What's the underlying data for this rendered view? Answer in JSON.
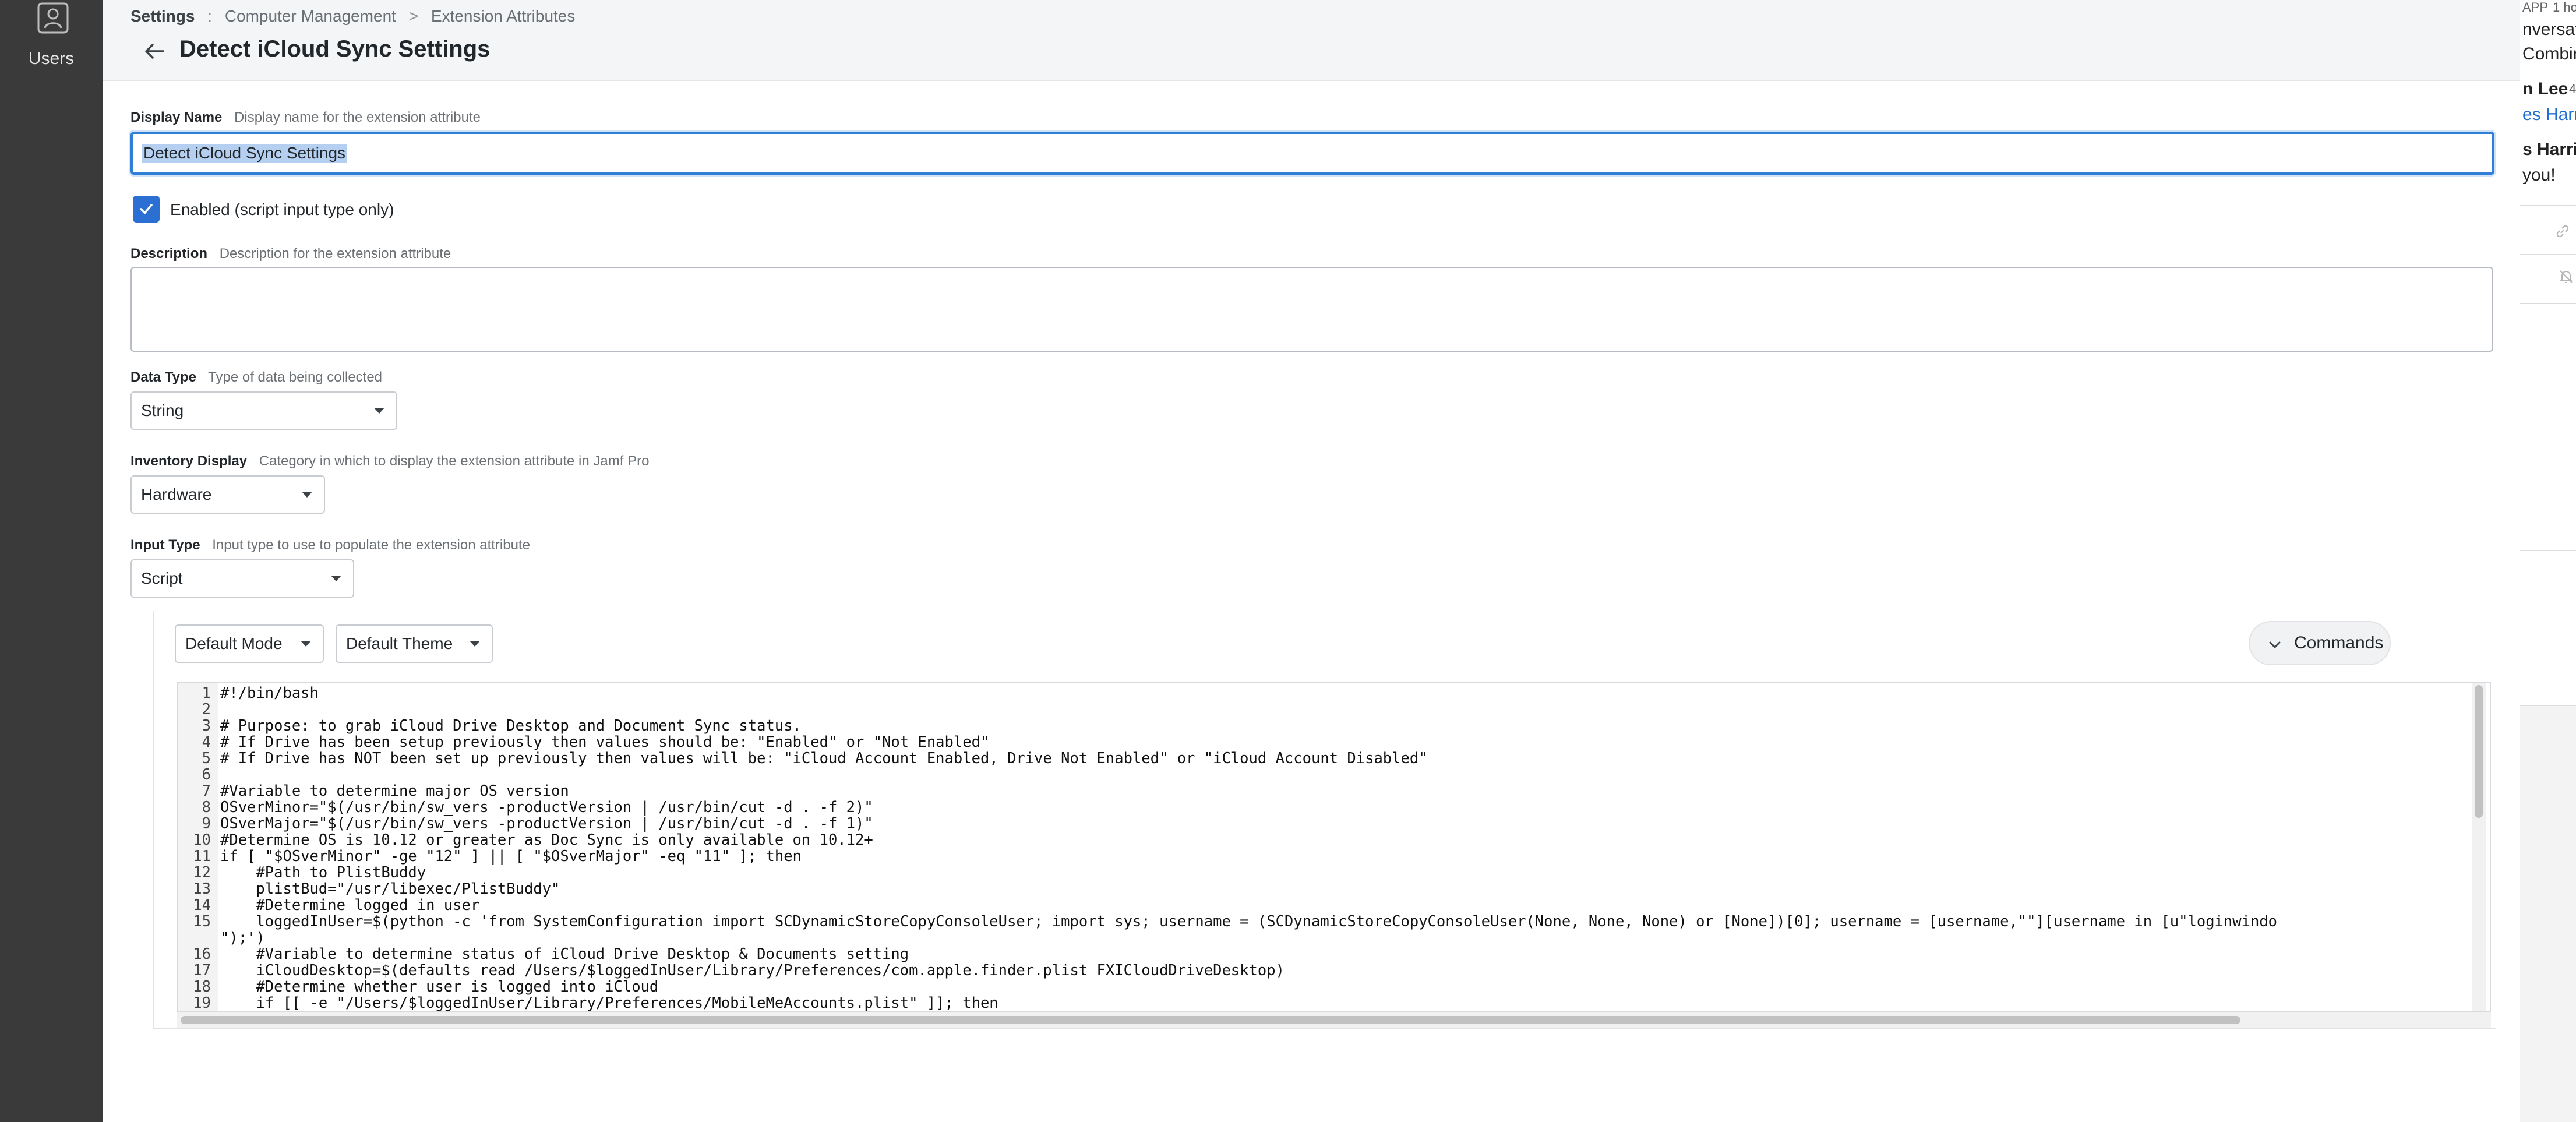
{
  "sidebar": {
    "users_label": "Users"
  },
  "header": {
    "breadcrumb": {
      "root": "Settings",
      "root_sep": ":",
      "item1": "Computer Management",
      "item_sep": ">",
      "item2": "Extension Attributes"
    },
    "title": "Detect iCloud Sync Settings"
  },
  "form": {
    "display_name": {
      "label": "Display Name",
      "help": "Display name for the extension attribute",
      "value": "Detect iCloud Sync Settings"
    },
    "enabled": {
      "label": "Enabled (script input type only)",
      "checked": true
    },
    "description": {
      "label": "Description",
      "help": "Description for the extension attribute",
      "value": ""
    },
    "data_type": {
      "label": "Data Type",
      "help": "Type of data being collected",
      "value": "String"
    },
    "inventory_display": {
      "label": "Inventory Display",
      "help": "Category in which to display the extension attribute in Jamf Pro",
      "value": "Hardware"
    },
    "input_type": {
      "label": "Input Type",
      "help": "Input type to use to populate the extension attribute",
      "value": "Script"
    }
  },
  "editor": {
    "mode": "Default Mode",
    "theme": "Default Theme",
    "decrease_font_icon": "text-decrease-icon",
    "increase_font_icon": "text-increase-icon",
    "commands_label": "Commands",
    "lines": [
      {
        "n": "1",
        "text": "#!/bin/bash"
      },
      {
        "n": "2",
        "text": ""
      },
      {
        "n": "3",
        "text": "# Purpose: to grab iCloud Drive Desktop and Document Sync status."
      },
      {
        "n": "4",
        "text": "# If Drive has been setup previously then values should be: \"Enabled\" or \"Not Enabled\""
      },
      {
        "n": "5",
        "text": "# If Drive has NOT been set up previously then values will be: \"iCloud Account Enabled, Drive Not Enabled\" or \"iCloud Account Disabled\""
      },
      {
        "n": "6",
        "text": ""
      },
      {
        "n": "7",
        "text": "#Variable to determine major OS version"
      },
      {
        "n": "8",
        "text": "OSverMinor=\"$(/usr/bin/sw_vers -productVersion | /usr/bin/cut -d . -f 2)\""
      },
      {
        "n": "9",
        "text": "OSverMajor=\"$(/usr/bin/sw_vers -productVersion | /usr/bin/cut -d . -f 1)\""
      },
      {
        "n": "10",
        "text": "#Determine OS is 10.12 or greater as Doc Sync is only available on 10.12+"
      },
      {
        "n": "11",
        "text": "if [ \"$OSverMinor\" -ge \"12\" ] || [ \"$OSverMajor\" -eq \"11\" ]; then"
      },
      {
        "n": "12",
        "text": "    #Path to PlistBuddy"
      },
      {
        "n": "13",
        "text": "    plistBud=\"/usr/libexec/PlistBuddy\""
      },
      {
        "n": "14",
        "text": "    #Determine logged in user"
      },
      {
        "n": "15",
        "text": "    loggedInUser=$(python -c 'from SystemConfiguration import SCDynamicStoreCopyConsoleUser; import sys; username = (SCDynamicStoreCopyConsoleUser(None, None, None) or [None])[0]; username = [username,\"\"][username in [u\"loginwindo"
      },
      {
        "n": "",
        "text": "\");')"
      },
      {
        "n": "16",
        "text": "    #Variable to determine status of iCloud Drive Desktop & Documents setting"
      },
      {
        "n": "17",
        "text": "    iCloudDesktop=$(defaults read /Users/$loggedInUser/Library/Preferences/com.apple.finder.plist FXICloudDriveDesktop)"
      },
      {
        "n": "18",
        "text": "    #Determine whether user is logged into iCloud"
      },
      {
        "n": "19",
        "text": "    if [[ -e \"/Users/$loggedInUser/Library/Preferences/MobileMeAccounts.plist\" ]]; then"
      }
    ]
  },
  "background_window": {
    "badge": "APP",
    "time": "1 ho",
    "line1": "nversatio",
    "line2": "Combin",
    "name1": "n Lee",
    "name1_time": "4",
    "link": "es Harr",
    "name2": "s Harris",
    "text2": "you!"
  }
}
